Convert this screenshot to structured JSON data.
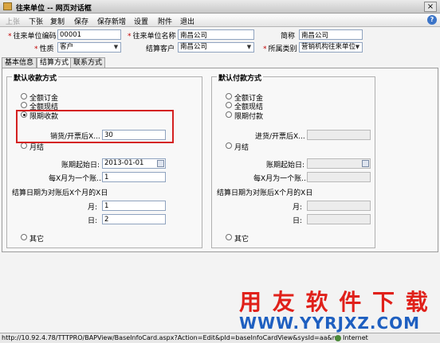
{
  "window": {
    "title": "往来单位 -- 网页对话框",
    "close_label": "×"
  },
  "toolbar": {
    "items": [
      "上张",
      "下张",
      "复制",
      "保存",
      "保存新增",
      "设置",
      "附件",
      "退出"
    ],
    "help_label": "?"
  },
  "header": {
    "code_label": "往来单位编码",
    "code_value": "00001",
    "name_label": "往来单位名称",
    "name_value": "南昌公司",
    "short_label": "简称",
    "short_value": "南昌公司",
    "nature_label": "性质",
    "nature_value": "客户",
    "settle_label": "结算客户",
    "settle_value": "南昌公司",
    "category_label": "所属类别",
    "category_value": "营销机构往来单位"
  },
  "tabs": [
    "基本信息",
    "结算方式",
    "联系方式"
  ],
  "collect": {
    "title": "默认收款方式",
    "full_order": "全额订金",
    "full_spec": "全额现结",
    "term": "限期收款",
    "term_days_label": "销货/开票后X...",
    "term_days_value": "30",
    "monthly": "月结",
    "start_label": "账期起始日:",
    "start_value": "2013-01-01",
    "every_label": "每X月为一个账...",
    "every_value": "1",
    "settle_day_label": "结算日期为对账后X个月的X日",
    "month_label": "月:",
    "month_value": "1",
    "day_label": "日:",
    "day_value": "2",
    "other": "其它"
  },
  "pay": {
    "title": "默认付款方式",
    "full_order": "全额订金",
    "full_spec": "全额现结",
    "term": "限期付款",
    "term_days_label": "进货/开票后X...",
    "monthly": "月结",
    "start_label": "账期起始日:",
    "every_label": "每X月为一个账...",
    "settle_day_label": "结算日期为对账后X个月的X日",
    "month_label": "月:",
    "day_label": "日:",
    "other": "其它"
  },
  "watermark": {
    "line1": "用 友 软 件 下 载",
    "line2": "WWW.YYRJXZ.COM"
  },
  "status": {
    "url": "http://10.92.4.78/TTTPRO/BAPView/BaseInfoCard.aspx?Action=Edit&pId=baseInfoCardView&sysId=aa&mId=aa10(",
    "zone": "Internet"
  },
  "colors": {
    "highlight": "#d42020",
    "watermark_red": "#e0201a",
    "watermark_blue": "#1e5fc0"
  }
}
